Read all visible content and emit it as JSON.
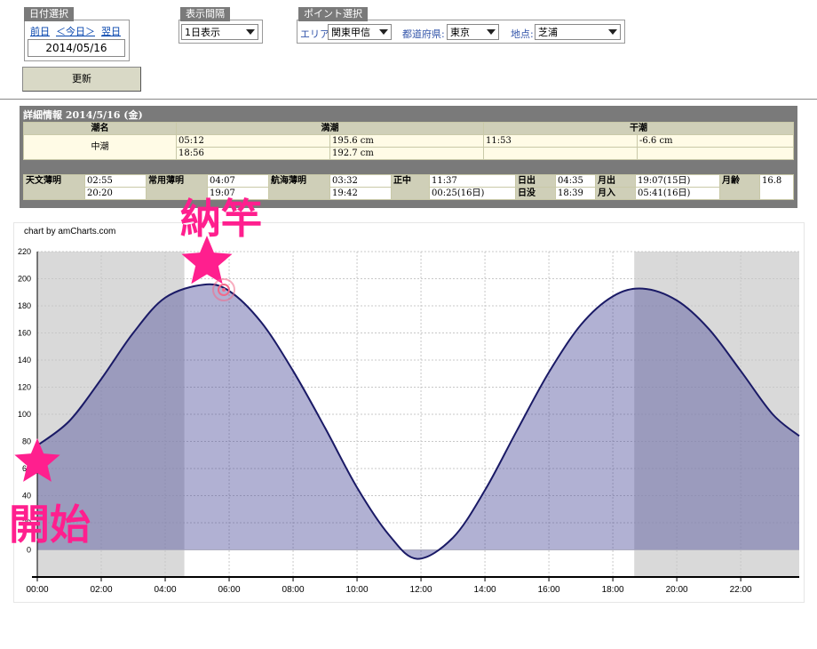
{
  "date_panel": {
    "tab_label": "日付選択",
    "prev_link": "前日",
    "today_link": "＜今日＞",
    "next_link": "翌日",
    "date_value": "2014/05/16"
  },
  "interval_panel": {
    "tab_label": "表示間隔",
    "selected": "1日表示"
  },
  "point_panel": {
    "tab_label": "ポイント選択",
    "area_label": "エリア:",
    "area_value": "関東甲信",
    "pref_label": "都道府県:",
    "pref_value": "東京",
    "spot_label": "地点:",
    "spot_value": "芝浦"
  },
  "update_button": "更新",
  "details": {
    "title": "詳細情報 2014/5/16 (金)",
    "tide_header": {
      "name": "潮名",
      "high": "満潮",
      "low": "干潮"
    },
    "tide_name": "中潮",
    "high_tides": [
      {
        "time": "05:12",
        "level": "195.6 cm"
      },
      {
        "time": "18:56",
        "level": "192.7 cm"
      }
    ],
    "low_tides": [
      {
        "time": "11:53",
        "level": "-6.6 cm"
      },
      {
        "time": "",
        "level": ""
      }
    ],
    "astro": {
      "astro_twilight_label": "天文薄明",
      "astro_twilight": [
        "02:55",
        "20:20"
      ],
      "civil_twilight_label": "常用薄明",
      "civil_twilight": [
        "04:07",
        "19:07"
      ],
      "nautical_twilight_label": "航海薄明",
      "nautical_twilight": [
        "03:32",
        "19:42"
      ],
      "noon_label": "正中",
      "noon": [
        "11:37",
        "00:25(16日)"
      ],
      "sunrise_label": "日出",
      "sunrise": "04:35",
      "sunset_label": "日没",
      "sunset": "18:39",
      "moonrise_label": "月出",
      "moonrise": "19:07(15日)",
      "moonset_label": "月入",
      "moonset": "05:41(16日)",
      "moon_age_label": "月齢",
      "moon_age": "16.8"
    }
  },
  "chart_credit": "chart by amCharts.com",
  "annotations": {
    "top": "納竿",
    "bottom": "開始",
    "color": "#ff1f8e"
  },
  "chart_data": {
    "type": "area",
    "xlabel": "",
    "ylabel": "",
    "ylim": [
      -20,
      220
    ],
    "yticks": [
      0,
      20,
      40,
      60,
      80,
      100,
      120,
      140,
      160,
      180,
      200,
      220
    ],
    "xlim": [
      0,
      23.83
    ],
    "xticks": [
      "00:00",
      "02:00",
      "04:00",
      "06:00",
      "08:00",
      "10:00",
      "12:00",
      "14:00",
      "16:00",
      "18:00",
      "20:00",
      "22:00"
    ],
    "night_shading": [
      [
        0,
        4.6
      ],
      [
        18.67,
        23.83
      ]
    ],
    "series": [
      {
        "x": [
          0,
          1,
          2,
          3,
          4,
          5.2,
          6,
          7,
          8,
          9,
          10,
          11,
          11.88,
          13,
          14,
          15,
          16,
          17,
          18,
          18.93,
          20,
          21,
          22,
          23,
          23.83
        ],
        "values": [
          77,
          95,
          126,
          160,
          186,
          195.6,
          191,
          168,
          132,
          90,
          46,
          11,
          -6.6,
          9,
          44,
          88,
          131,
          166,
          187,
          192.7,
          184,
          163,
          132,
          100,
          84
        ]
      }
    ],
    "grid": true,
    "colors": {
      "fill": "#b0b0cf",
      "line": "#1a1a66",
      "night": "#d9d9d9"
    }
  }
}
